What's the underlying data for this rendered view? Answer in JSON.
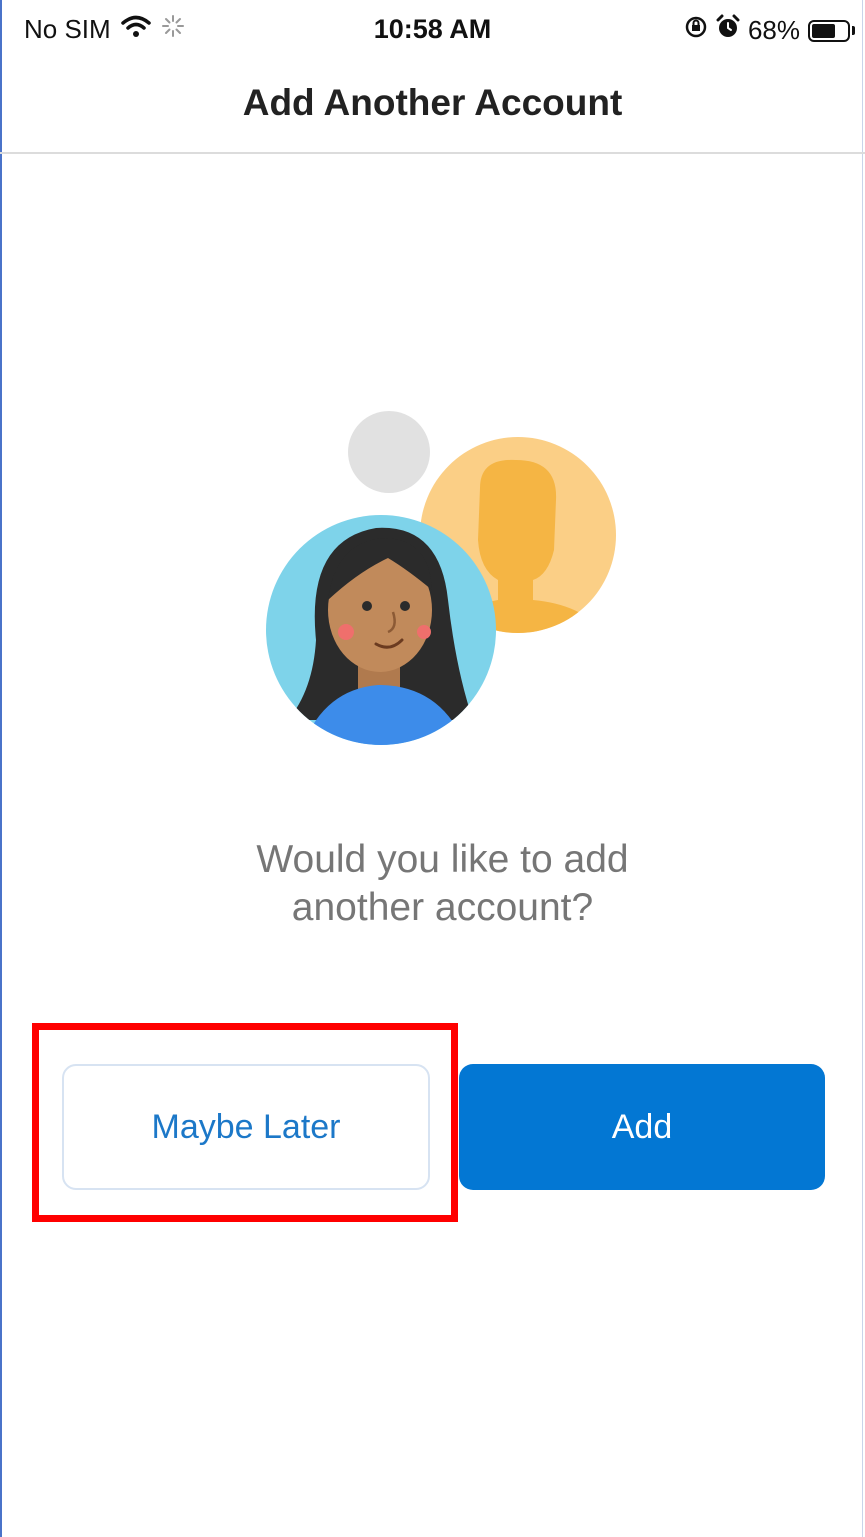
{
  "status_bar": {
    "carrier": "No SIM",
    "time": "10:58 AM",
    "battery_percent": "68%",
    "battery_level": 0.68
  },
  "nav": {
    "title": "Add Another Account"
  },
  "prompt": {
    "line1": "Would you like to add",
    "line2": "another account?"
  },
  "buttons": {
    "maybe_later": "Maybe Later",
    "add": "Add"
  },
  "colors": {
    "primary": "#0377d3",
    "secondary_text": "#1c78c8",
    "highlight": "#ff0000"
  },
  "icons": [
    "wifi-icon",
    "activity-spinner-icon",
    "orientation-lock-icon",
    "alarm-icon",
    "battery-icon"
  ]
}
